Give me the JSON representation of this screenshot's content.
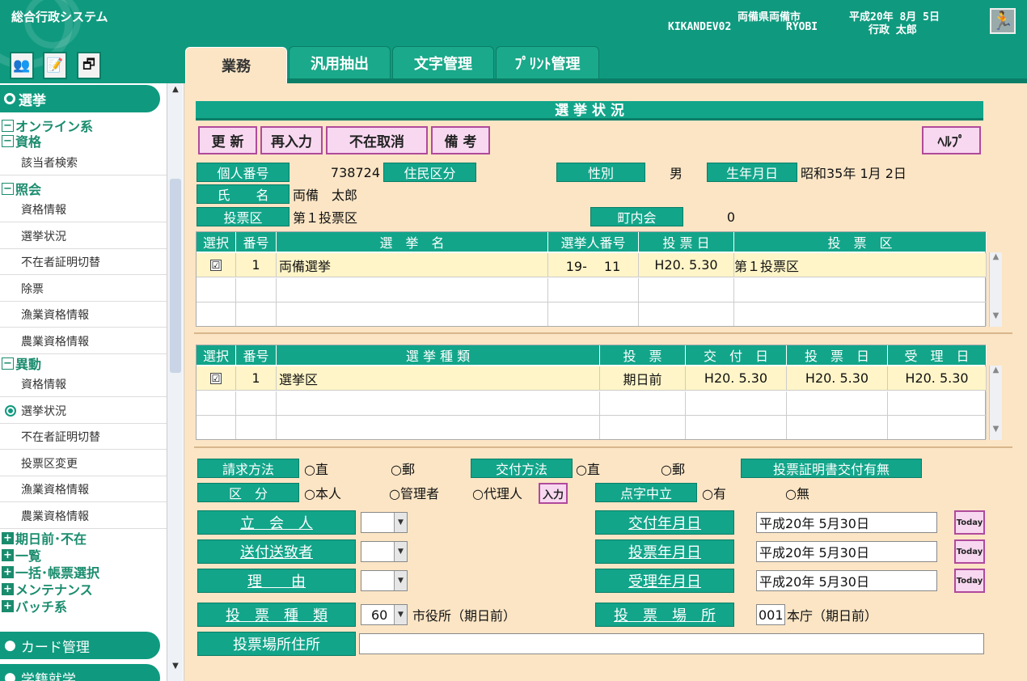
{
  "app": {
    "title": "総合行政システム"
  },
  "header": {
    "org": "両備県両備市",
    "user_id": "KIKANDEV02",
    "org_code": "RYOBI",
    "date": "平成20年 8月 5日",
    "user_name": "行政 太郎"
  },
  "toolbar_icons": [
    "users-icon",
    "edit-icon",
    "windows-icon"
  ],
  "tabs": [
    "業務",
    "汎用抽出",
    "文字管理",
    "ﾌﾟﾘﾝﾄ管理"
  ],
  "sidebar": {
    "group_top": "選挙",
    "cat_online": "オンライン系",
    "cat_shikaku": "資格",
    "item_gaitou": "該当者検索",
    "cat_shoukai": "照会",
    "items_shoukai": [
      "資格情報",
      "選挙状況",
      "不在者証明切替",
      "除票",
      "漁業資格情報",
      "農業資格情報"
    ],
    "cat_idou": "異動",
    "items_idou": [
      "資格情報",
      "選挙状況",
      "不在者証明切替",
      "投票区変更",
      "漁業資格情報",
      "農業資格情報"
    ],
    "cat_more": [
      "期日前･不在",
      "一覧",
      "一括･帳票選択",
      "メンテナンス",
      "バッチ系"
    ],
    "group_card": "カード管理",
    "group_next": "学籍就学"
  },
  "page": {
    "title": "選 挙 状 況"
  },
  "buttons": {
    "refresh": "更 新",
    "reenter": "再入力",
    "cancel_absent": "不在取消",
    "notes": "備 考",
    "help": "ﾍﾙﾌﾟ"
  },
  "person": {
    "id_label": "個人番号",
    "id_value": "738724",
    "resident_label": "住民区分",
    "resident_value": "",
    "gender_label": "性別",
    "gender_value": "男",
    "birth_label": "生年月日",
    "birth_value": "昭和35年 1月 2日",
    "name_label": "氏　　名",
    "name_value": "両備　太郎",
    "district_label": "投票区",
    "district_value": "第１投票区",
    "town_label": "町内会",
    "town_value": "0"
  },
  "table1": {
    "headers": [
      "選択",
      "番号",
      "選　挙　名",
      "選挙人番号",
      "投 票 日",
      "投　票　区"
    ],
    "row": {
      "checked": "☑",
      "no": "1",
      "name": "両備選挙",
      "voter_no": "19-　 11",
      "date": "H20. 5.30",
      "district": "第１投票区"
    }
  },
  "table2": {
    "headers": [
      "選択",
      "番号",
      "選 挙 種 類",
      "投　票",
      "交　付　日",
      "投　票　日",
      "受　理　日"
    ],
    "row": {
      "checked": "☑",
      "no": "1",
      "type": "選挙区",
      "vote": "期日前",
      "issue": "H20. 5.30",
      "votedate": "H20. 5.30",
      "receipt": "H20. 5.30"
    }
  },
  "form": {
    "request_label": "請求方法",
    "request_opts": [
      "○直",
      "○郵"
    ],
    "delivery_label": "交付方法",
    "delivery_opts": [
      "○直",
      "○郵"
    ],
    "cert_label": "投票証明書交付有無",
    "cert_value": "",
    "category_label": "区　分",
    "category_opts": [
      "○本人",
      "○管理者",
      "○代理人"
    ],
    "input_btn": "入力",
    "braille_label": "点字中立",
    "braille_opts": [
      "○有",
      "○無"
    ],
    "witness_label": "立　会　人",
    "sender_label": "送付送致者",
    "reason_label": "理　　由",
    "issue_date_label": "交付年月日",
    "issue_date": "平成20年 5月30日",
    "vote_date_label": "投票年月日",
    "vote_date": "平成20年 5月30日",
    "receipt_date_label": "受理年月日",
    "receipt_date": "平成20年 5月30日",
    "today": "Today",
    "vote_type_label": "投　票　種　類",
    "vote_type_code": "60",
    "vote_type_name": "市役所（期日前）",
    "vote_place_label": "投　票　場　所",
    "vote_place_code": "001",
    "vote_place_name": "本庁（期日前）",
    "vote_addr_label": "投票場所住所",
    "vote_addr": ""
  }
}
